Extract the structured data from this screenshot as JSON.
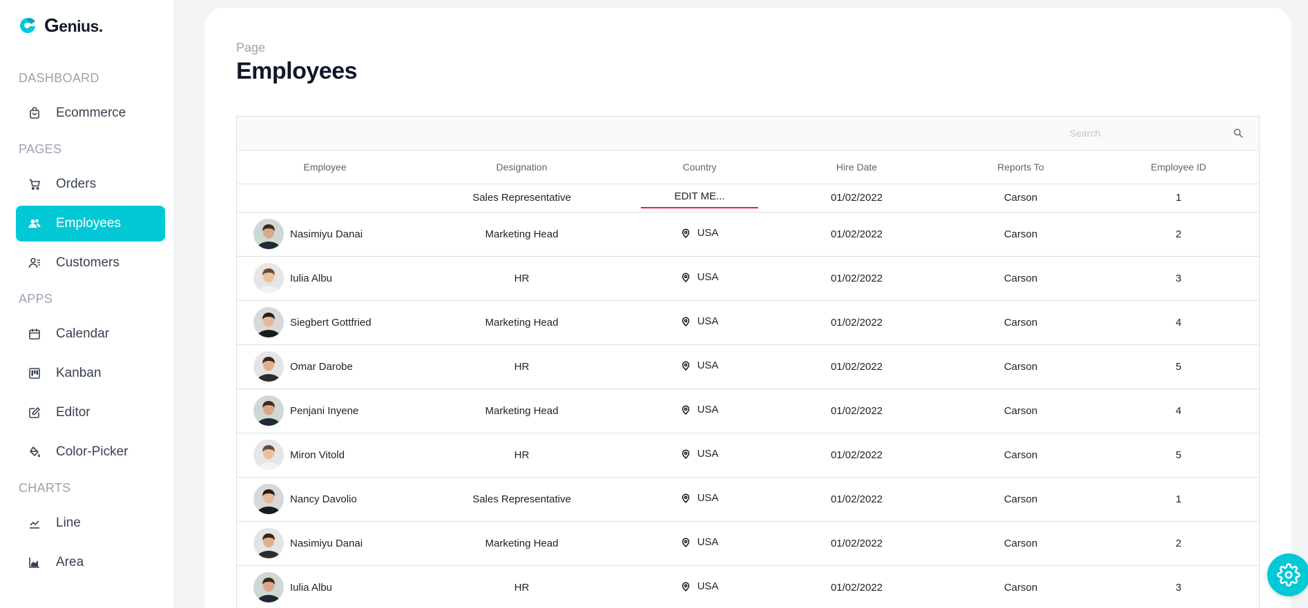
{
  "brand": {
    "initial": "G",
    "name": "enius."
  },
  "sidebar": {
    "sections": [
      {
        "title": "DASHBOARD",
        "items": [
          {
            "label": "Ecommerce",
            "icon": "shopping-bag-icon"
          }
        ]
      },
      {
        "title": "PAGES",
        "items": [
          {
            "label": "Orders",
            "icon": "cart-icon"
          },
          {
            "label": "Employees",
            "icon": "employees-icon",
            "active": true
          },
          {
            "label": "Customers",
            "icon": "customers-icon"
          }
        ]
      },
      {
        "title": "APPS",
        "items": [
          {
            "label": "Calendar",
            "icon": "calendar-icon"
          },
          {
            "label": "Kanban",
            "icon": "kanban-icon"
          },
          {
            "label": "Editor",
            "icon": "edit-icon"
          },
          {
            "label": "Color-Picker",
            "icon": "paint-bucket-icon"
          }
        ]
      },
      {
        "title": "CHARTS",
        "items": [
          {
            "label": "Line",
            "icon": "line-chart-icon"
          },
          {
            "label": "Area",
            "icon": "area-chart-icon"
          }
        ]
      }
    ]
  },
  "header": {
    "label": "Page",
    "title": "Employees"
  },
  "search": {
    "placeholder": "Search"
  },
  "grid": {
    "columns": [
      "Employee",
      "Designation",
      "Country",
      "Hire Date",
      "Reports To",
      "Employee ID"
    ],
    "edit_row": {
      "designation": "Sales Representative",
      "country_input": "EDIT ME...",
      "hire_date": "01/02/2022",
      "reports_to": "Carson",
      "id": "1"
    },
    "rows": [
      {
        "name": "Nasimiyu Danai",
        "designation": "Marketing Head",
        "country": "USA",
        "hire_date": "01/02/2022",
        "reports_to": "Carson",
        "id": "2"
      },
      {
        "name": "Iulia Albu",
        "designation": "HR",
        "country": "USA",
        "hire_date": "01/02/2022",
        "reports_to": "Carson",
        "id": "3"
      },
      {
        "name": "Siegbert Gottfried",
        "designation": "Marketing Head",
        "country": "USA",
        "hire_date": "01/02/2022",
        "reports_to": "Carson",
        "id": "4"
      },
      {
        "name": "Omar Darobe",
        "designation": "HR",
        "country": "USA",
        "hire_date": "01/02/2022",
        "reports_to": "Carson",
        "id": "5"
      },
      {
        "name": "Penjani Inyene",
        "designation": "Marketing Head",
        "country": "USA",
        "hire_date": "01/02/2022",
        "reports_to": "Carson",
        "id": "4"
      },
      {
        "name": "Miron Vitold",
        "designation": "HR",
        "country": "USA",
        "hire_date": "01/02/2022",
        "reports_to": "Carson",
        "id": "5"
      },
      {
        "name": "Nancy Davolio",
        "designation": "Sales Representative",
        "country": "USA",
        "hire_date": "01/02/2022",
        "reports_to": "Carson",
        "id": "1"
      },
      {
        "name": "Nasimiyu Danai",
        "designation": "Marketing Head",
        "country": "USA",
        "hire_date": "01/02/2022",
        "reports_to": "Carson",
        "id": "2"
      },
      {
        "name": "Iulia Albu",
        "designation": "HR",
        "country": "USA",
        "hire_date": "01/02/2022",
        "reports_to": "Carson",
        "id": "3"
      }
    ]
  },
  "colors": {
    "accent": "#03c9d7",
    "edit_underline": "#e3165b"
  },
  "settings_button": {
    "icon": "gear-icon"
  }
}
